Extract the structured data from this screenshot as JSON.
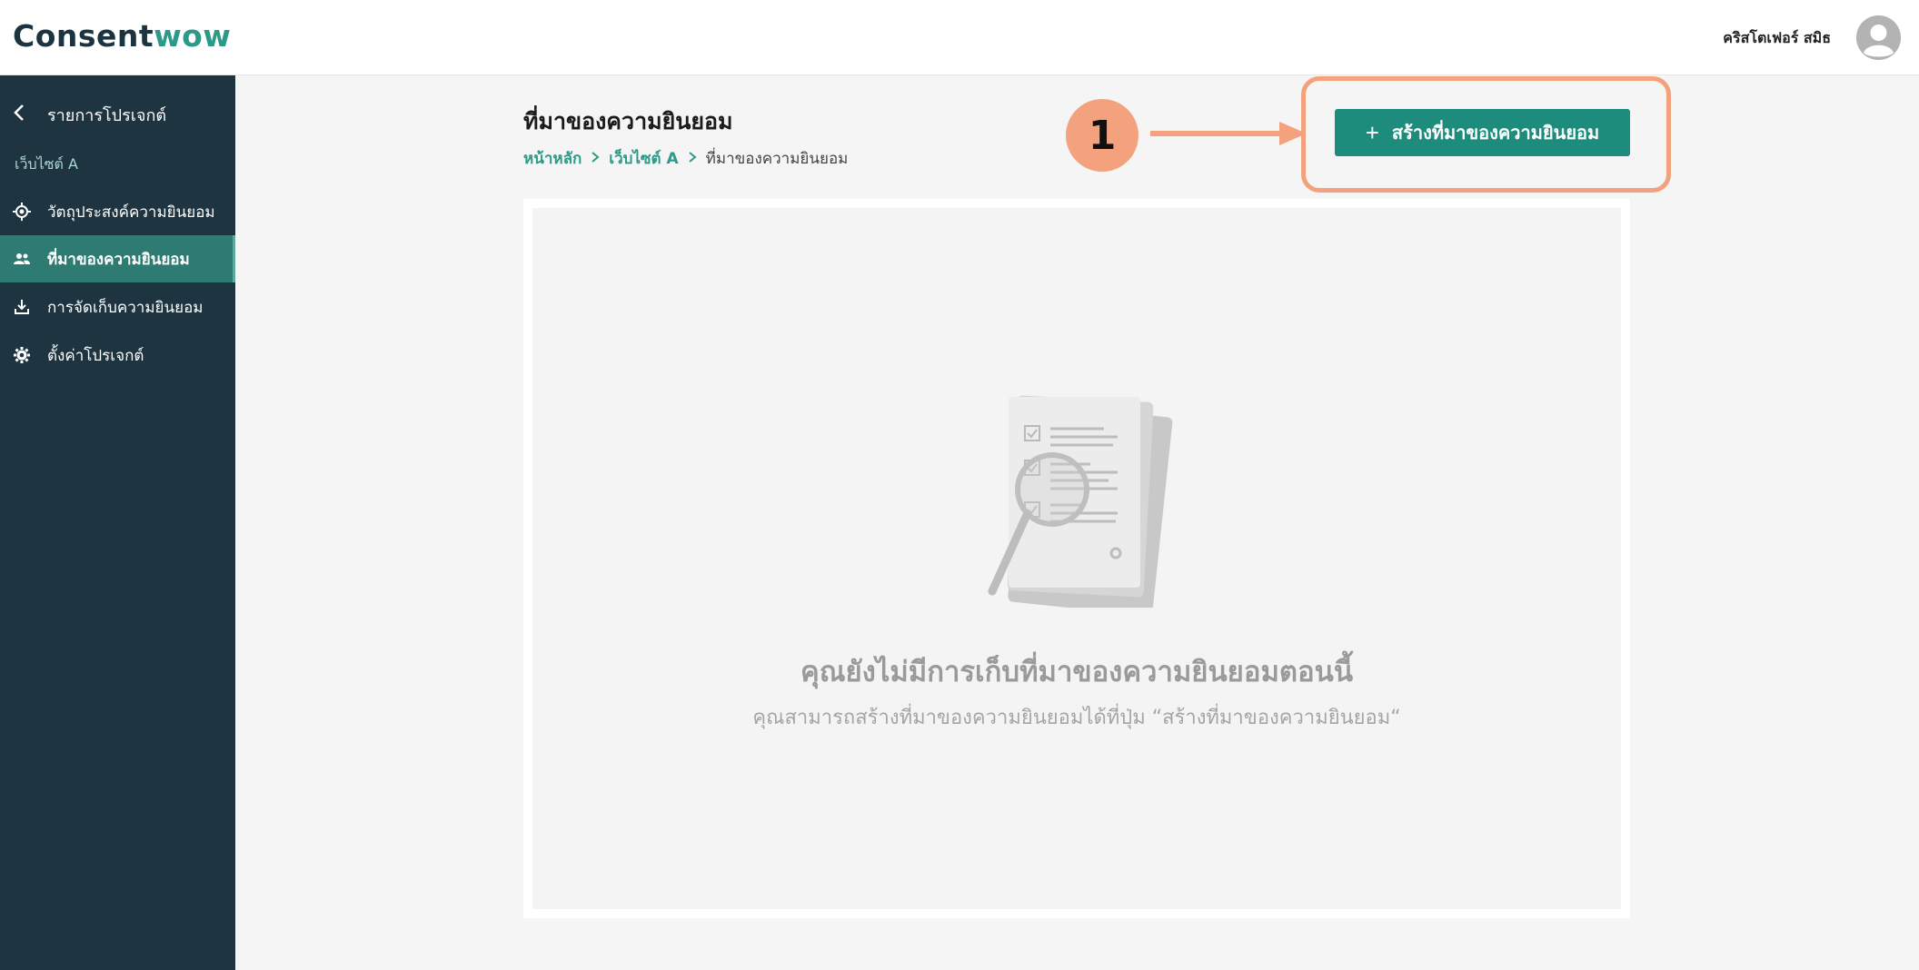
{
  "header": {
    "logo_part1": "Consent",
    "logo_part2": "wow",
    "user_name": "คริสโตเฟอร์ สมิธ"
  },
  "sidebar": {
    "back_label": "รายการโปรเจกต์",
    "group_label": "เว็บไซต์ A",
    "items": [
      {
        "label": "วัตถุประสงค์ความยินยอม",
        "icon": "target-icon"
      },
      {
        "label": "ที่มาของความยินยอม",
        "icon": "users-icon",
        "active": true
      },
      {
        "label": "การจัดเก็บความยินยอม",
        "icon": "download-icon"
      },
      {
        "label": "ตั้งค่าโปรเจกต์",
        "icon": "gear-icon"
      }
    ]
  },
  "main": {
    "title": "ที่มาของความยินยอม",
    "breadcrumb": [
      "หน้าหลัก",
      "เว็บไซต์ A",
      "ที่มาของความยินยอม"
    ],
    "create_button": "สร้างที่มาของความยินยอม",
    "step_number": "1",
    "empty_title": "คุณยังไม่มีการเก็บที่มาของความยินยอมตอนนี้",
    "empty_subtitle": "คุณสามารถสร้างที่มาของความยินยอมได้ที่ปุ่ม “สร้างที่มาของความยินยอม“"
  },
  "colors": {
    "brand_dark": "#1e3440",
    "brand_teal": "#2b9a88",
    "annotation_orange": "#f4a27e"
  }
}
